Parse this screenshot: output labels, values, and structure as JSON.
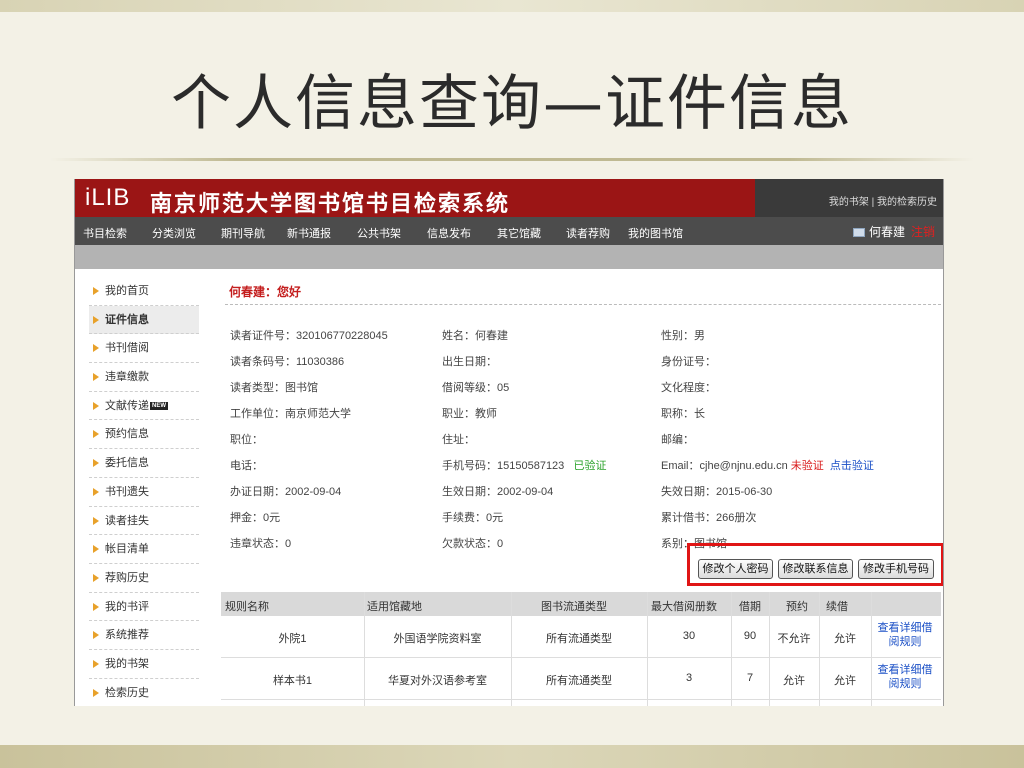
{
  "slide": {
    "title": "个人信息查询—证件信息"
  },
  "header": {
    "logo": "iLIB",
    "site_name": "南京师范大学图书馆书目检索系统",
    "top_links": "我的书架 | 我的检索历史"
  },
  "nav": {
    "items": [
      "书目检索",
      "分类浏览",
      "期刊导航",
      "新书通报",
      "公共书架",
      "信息发布",
      "其它馆藏",
      "读者荐购",
      "我的图书馆"
    ],
    "user_name": "何春建",
    "logout": "注销"
  },
  "sidebar": {
    "items": [
      {
        "label": "我的首页"
      },
      {
        "label": "证件信息"
      },
      {
        "label": "书刊借阅"
      },
      {
        "label": "违章缴款"
      },
      {
        "label": "文献传递",
        "badge": "NEW"
      },
      {
        "label": "预约信息"
      },
      {
        "label": "委托信息"
      },
      {
        "label": "书刊遗失"
      },
      {
        "label": "读者挂失"
      },
      {
        "label": "帐目清单"
      },
      {
        "label": "荐购历史"
      },
      {
        "label": "我的书评"
      },
      {
        "label": "系统推荐"
      },
      {
        "label": "我的书架"
      },
      {
        "label": "检索历史"
      }
    ]
  },
  "main": {
    "greeting": "何春建：您好",
    "rows": [
      [
        "读者证件号：320106770228045",
        "姓名：何春建",
        "性别：男"
      ],
      [
        "读者条码号：11030386",
        "出生日期：",
        "身份证号："
      ],
      [
        "读者类型：图书馆",
        "借阅等级：05",
        "文化程度："
      ],
      [
        "工作单位：南京师范大学",
        "职业：教师",
        "职称：长"
      ],
      [
        "职位：",
        "住址：",
        "邮编："
      ],
      [
        "电话：",
        "手机号码：15150587123",
        "Email：cjhe@njnu.edu.cn"
      ],
      [
        "办证日期：2002-09-04",
        "生效日期：2002-09-04",
        "失效日期：2015-06-30"
      ],
      [
        "押金：0元",
        "手续费：0元",
        "累计借书：266册次"
      ],
      [
        "违章状态：0",
        "欠款状态：0",
        "系别：图书馆"
      ]
    ],
    "phone_verified": "已验证",
    "email_unverified": "未验证",
    "email_verify_link": "点击验证",
    "buttons": {
      "change_password": "修改个人密码",
      "change_contact": "修改联系信息",
      "change_phone": "修改手机号码"
    }
  },
  "rules_table": {
    "headers": [
      "规则名称",
      "适用馆藏地",
      "图书流通类型",
      "最大借阅册数",
      "借期",
      "预约",
      "续借",
      ""
    ],
    "rows": [
      [
        "外院1",
        "外国语学院资料室",
        "所有流通类型",
        "30",
        "90",
        "不允许",
        "允许",
        "查看详细借阅规则"
      ],
      [
        "样本书1",
        "华夏对外汉语参考室",
        "所有流通类型",
        "3",
        "7",
        "允许",
        "允许",
        "查看详细借阅规则"
      ]
    ]
  },
  "colors": {
    "brand_red": "#9b1515",
    "nav_gray": "#4c4c4c",
    "highlight_red": "#e01515"
  }
}
